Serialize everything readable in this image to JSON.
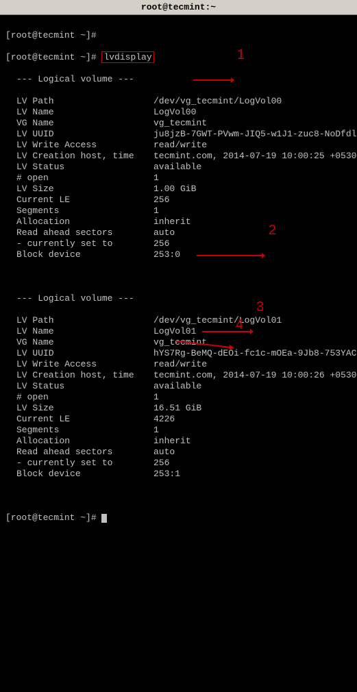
{
  "titlebar": "root@tecmint:~",
  "prompt1": "[root@tecmint ~]# ",
  "prompt2": "[root@tecmint ~]# ",
  "command": "lvdisplay",
  "prompt3": "[root@tecmint ~]# ",
  "vol1": {
    "header": "--- Logical volume ---",
    "rows": [
      {
        "label": "LV Path",
        "value": "/dev/vg_tecmint/LogVol00"
      },
      {
        "label": "LV Name",
        "value": "LogVol00"
      },
      {
        "label": "VG Name",
        "value": "vg_tecmint"
      },
      {
        "label": "LV UUID",
        "value": "ju8jzB-7GWT-PVwm-JIQ5-w1J1-zuc8-NoDfdl"
      },
      {
        "label": "LV Write Access",
        "value": "read/write"
      },
      {
        "label": "LV Creation host, time",
        "value": "tecmint.com, 2014-07-19 10:00:25 +0530"
      },
      {
        "label": "LV Status",
        "value": "available"
      },
      {
        "label": "# open",
        "value": "1"
      },
      {
        "label": "LV Size",
        "value": "1.00 GiB"
      },
      {
        "label": "Current LE",
        "value": "256"
      },
      {
        "label": "Segments",
        "value": "1"
      },
      {
        "label": "Allocation",
        "value": "inherit"
      },
      {
        "label": "Read ahead sectors",
        "value": "auto"
      },
      {
        "label": "- currently set to",
        "value": "256"
      },
      {
        "label": "Block device",
        "value": "253:0"
      }
    ]
  },
  "vol2": {
    "header": "--- Logical volume ---",
    "rows": [
      {
        "label": "LV Path",
        "value": "/dev/vg_tecmint/LogVol01"
      },
      {
        "label": "LV Name",
        "value": "LogVol01"
      },
      {
        "label": "VG Name",
        "value": "vg_tecmint"
      },
      {
        "label": "LV UUID",
        "value": "hYS7Rg-BeMQ-dEOi-fc1c-mOEa-9Jb8-753YAC"
      },
      {
        "label": "LV Write Access",
        "value": "read/write"
      },
      {
        "label": "LV Creation host, time",
        "value": "tecmint.com, 2014-07-19 10:00:26 +0530"
      },
      {
        "label": "LV Status",
        "value": "available"
      },
      {
        "label": "# open",
        "value": "1"
      },
      {
        "label": "LV Size",
        "value": "16.51 GiB"
      },
      {
        "label": "Current LE",
        "value": "4226"
      },
      {
        "label": "Segments",
        "value": "1"
      },
      {
        "label": "Allocation",
        "value": "inherit"
      },
      {
        "label": "Read ahead sectors",
        "value": "auto"
      },
      {
        "label": "- currently set to",
        "value": "256"
      },
      {
        "label": "Block device",
        "value": "253:1"
      }
    ]
  },
  "annotations": {
    "a1": "1",
    "a2": "2",
    "a3": "3",
    "a4": "4"
  }
}
